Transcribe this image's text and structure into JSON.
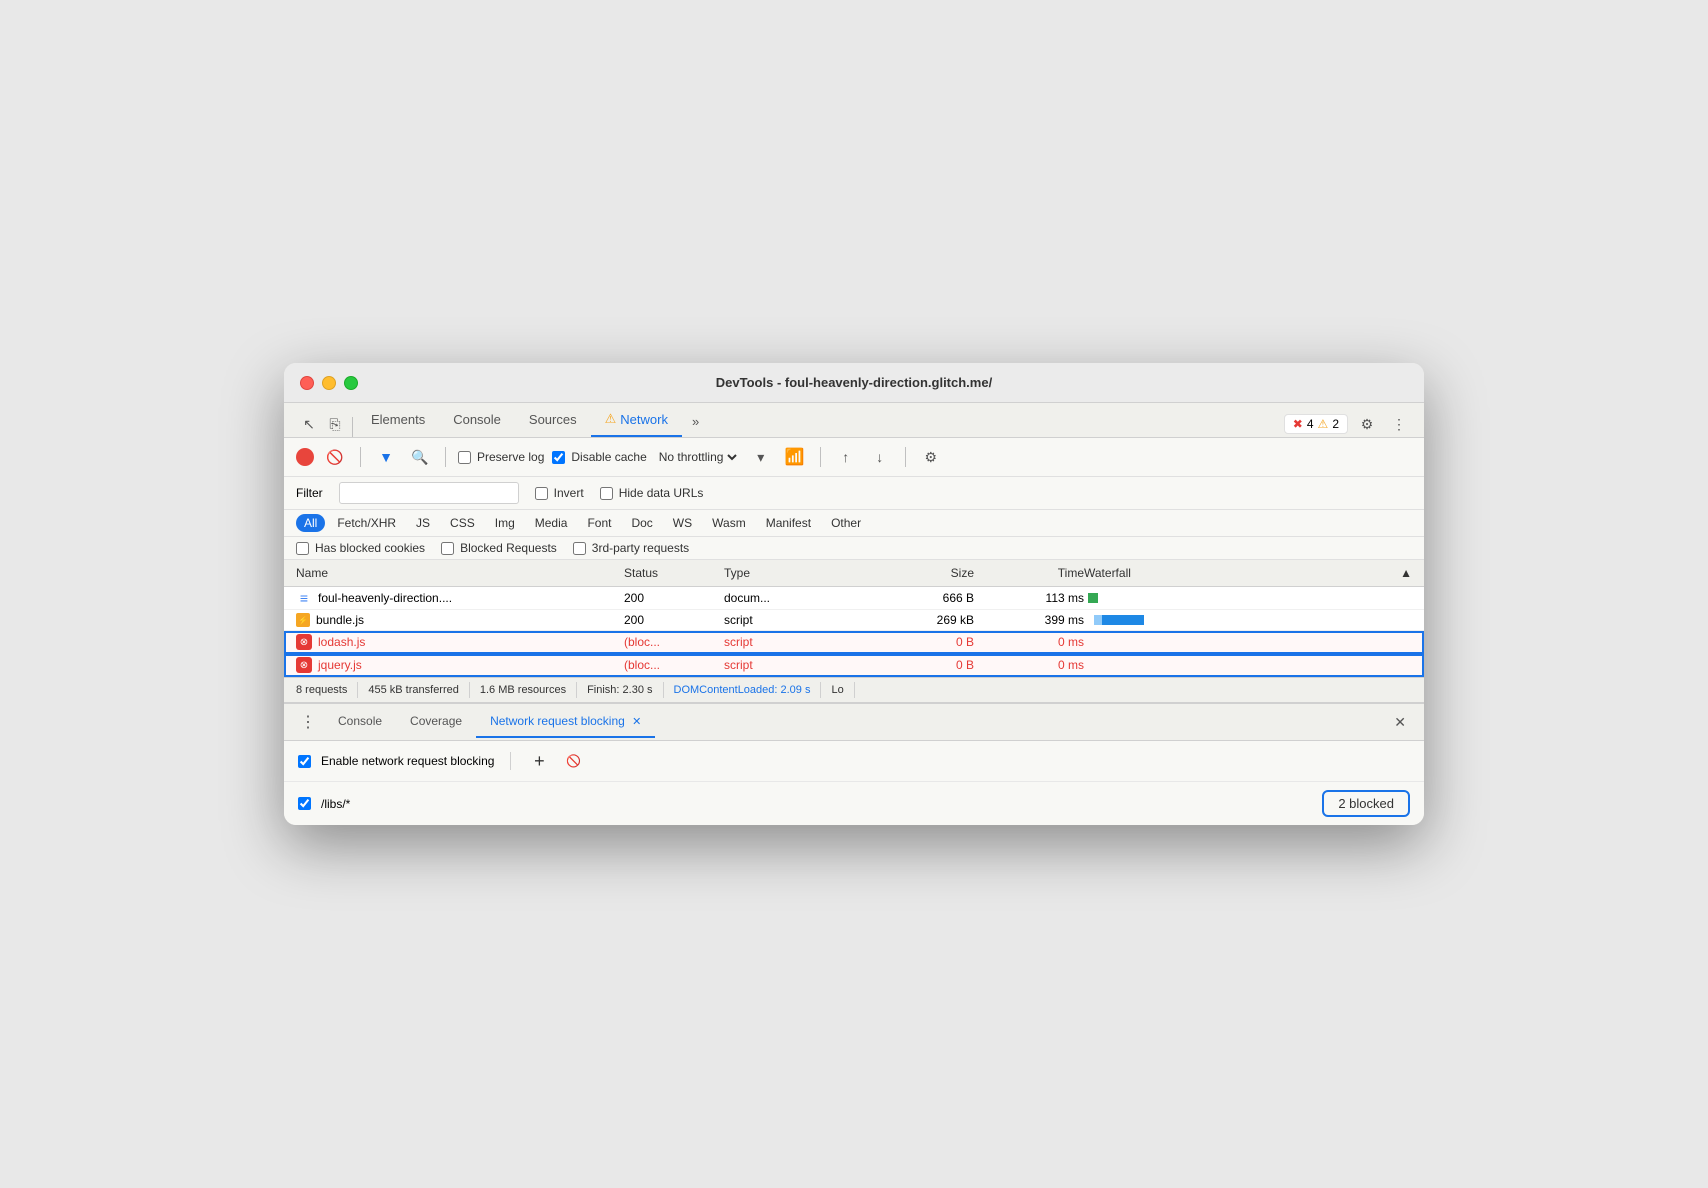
{
  "window": {
    "title": "DevTools - foul-heavenly-direction.glitch.me/"
  },
  "toolbar_tabs": {
    "pointer_icon": "↖",
    "copy_icon": "⎘",
    "elements": "Elements",
    "console": "Console",
    "sources": "Sources",
    "network_warning": "⚠",
    "network": "Network",
    "more": "»",
    "errors": "✖ 4",
    "warnings": "⚠ 2",
    "settings": "⚙",
    "more_vert": "⋮"
  },
  "network_toolbar": {
    "record_title": "Record",
    "clear": "🚫",
    "filter_icon": "▼",
    "search_icon": "🔍",
    "preserve_log": "Preserve log",
    "disable_cache": "Disable cache",
    "no_throttling": "No throttling",
    "wifi_icon": "WiFi",
    "upload_icon": "↑",
    "download_icon": "↓",
    "settings_icon": "⚙"
  },
  "filter_row": {
    "label": "Filter",
    "invert": "Invert",
    "hide_data_urls": "Hide data URLs"
  },
  "type_filters": [
    {
      "id": "all",
      "label": "All",
      "active": true
    },
    {
      "id": "fetch",
      "label": "Fetch/XHR",
      "active": false
    },
    {
      "id": "js",
      "label": "JS",
      "active": false
    },
    {
      "id": "css",
      "label": "CSS",
      "active": false
    },
    {
      "id": "img",
      "label": "Img",
      "active": false
    },
    {
      "id": "media",
      "label": "Media",
      "active": false
    },
    {
      "id": "font",
      "label": "Font",
      "active": false
    },
    {
      "id": "doc",
      "label": "Doc",
      "active": false
    },
    {
      "id": "ws",
      "label": "WS",
      "active": false
    },
    {
      "id": "wasm",
      "label": "Wasm",
      "active": false
    },
    {
      "id": "manifest",
      "label": "Manifest",
      "active": false
    },
    {
      "id": "other",
      "label": "Other",
      "active": false
    }
  ],
  "checkbox_row": {
    "blocked_cookies": "Has blocked cookies",
    "blocked_requests": "Blocked Requests",
    "third_party": "3rd-party requests"
  },
  "table": {
    "columns": [
      "Name",
      "Status",
      "Type",
      "Size",
      "Time",
      "Waterfall"
    ],
    "rows": [
      {
        "name": "foul-heavenly-direction....",
        "icon_type": "doc",
        "status": "200",
        "type": "docum...",
        "size": "666 B",
        "time": "113 ms",
        "blocked": false,
        "bar": {
          "type": "green",
          "offset": 2,
          "width": 8
        }
      },
      {
        "name": "bundle.js",
        "icon_type": "js",
        "status": "200",
        "type": "script",
        "size": "269 kB",
        "time": "399 ms",
        "blocked": false,
        "bar": {
          "type": "teal",
          "offset": 8,
          "width": 40
        }
      },
      {
        "name": "lodash.js",
        "icon_type": "blocked",
        "status": "(bloc...",
        "type": "script",
        "size": "0 B",
        "time": "0 ms",
        "blocked": true,
        "bar": null
      },
      {
        "name": "jquery.js",
        "icon_type": "blocked",
        "status": "(bloc...",
        "type": "script",
        "size": "0 B",
        "time": "0 ms",
        "blocked": true,
        "bar": null
      }
    ]
  },
  "status_bar": {
    "requests": "8 requests",
    "transferred": "455 kB transferred",
    "resources": "1.6 MB resources",
    "finish": "Finish: 2.30 s",
    "dom_loaded": "DOMContentLoaded: 2.09 s",
    "load": "Lo"
  },
  "bottom_panel": {
    "tabs": [
      {
        "label": "Console",
        "active": false
      },
      {
        "label": "Coverage",
        "active": false
      },
      {
        "label": "Network request blocking",
        "active": true,
        "closeable": true
      }
    ],
    "enable_label": "Enable network request blocking",
    "add_icon": "+",
    "cancel_icon": "🚫",
    "pattern": "/libs/*",
    "blocked_count": "2 blocked"
  }
}
